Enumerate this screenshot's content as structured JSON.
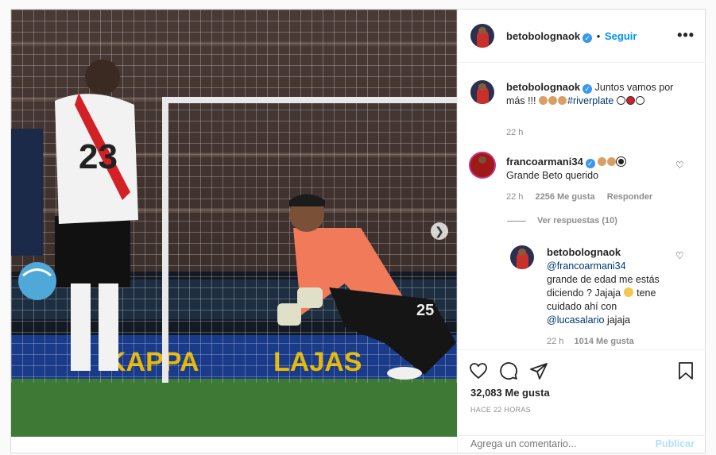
{
  "post": {
    "author": "betobolognaok",
    "follow_label": "Seguir",
    "more_label": "•••",
    "media_alt": "Arquero de River Plate atajando"
  },
  "caption": {
    "author": "betobolognaok",
    "text": "Juntos vamos por",
    "text2": "más !!!",
    "hashtag": "#riverplate",
    "time": "22 h"
  },
  "comments": [
    {
      "author": "francoarmani34",
      "text": "Grande Beto querido",
      "time": "22 h",
      "likes": "2256 Me gusta",
      "reply_label": "Responder",
      "view_replies": "Ver respuestas (10)"
    },
    {
      "author": "betobolognaok",
      "mention1": "@francoarmani34",
      "line2": "grande de edad me estás",
      "line3": "diciendo ? Jajaja",
      "line3b": "tene",
      "line4": "cuidado ahí con",
      "mention2": "@lucasalario",
      "line5": "jajaja",
      "time": "22 h",
      "likes": "1014 Me gusta"
    }
  ],
  "actions": {
    "likes_count": "32,083 Me gusta",
    "time_ago": "HACE 22 HORAS",
    "comment_placeholder": "Agrega un comentario...",
    "publish_label": "Publicar"
  },
  "colors": {
    "accent": "#0095f6",
    "verified": "#3897f0",
    "muted": "#8e8e8e"
  },
  "icons": [
    "heart-icon",
    "comment-icon",
    "share-icon",
    "bookmark-icon",
    "verified-icon",
    "chevron-right-icon"
  ]
}
